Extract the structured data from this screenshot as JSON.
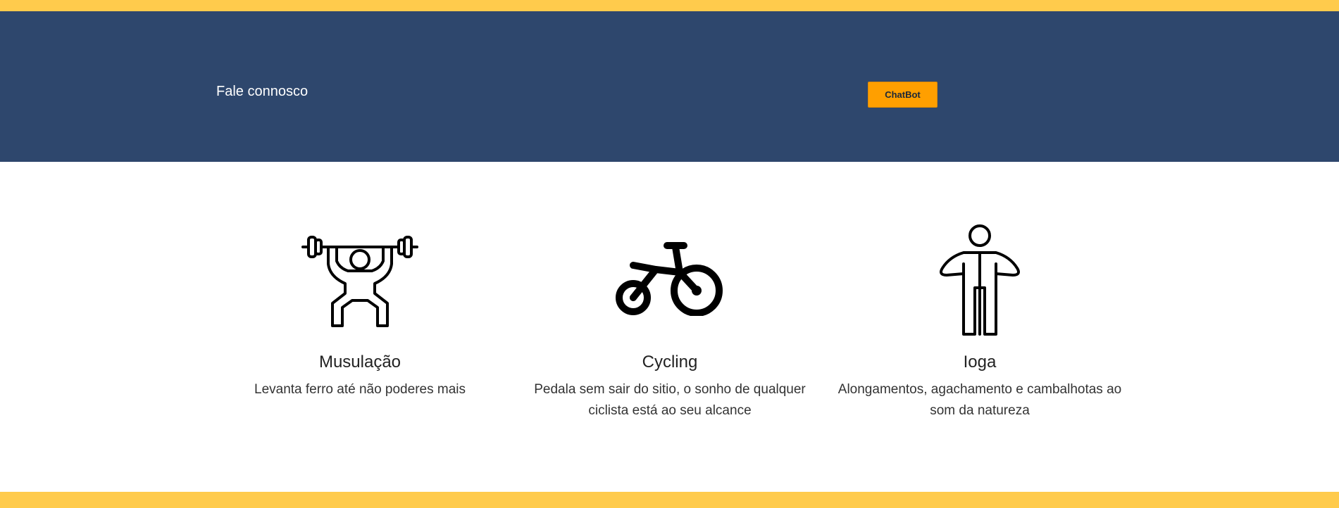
{
  "header": {
    "contact_title": "Fale connosco",
    "chatbot_label": "ChatBot"
  },
  "services": [
    {
      "icon": "weightlifting-icon",
      "title": "Musulação",
      "description": "Levanta ferro até não poderes mais"
    },
    {
      "icon": "bicycle-icon",
      "title": "Cycling",
      "description": "Pedala sem sair do sitio, o sonho de qualquer ciclista está ao seu alcance"
    },
    {
      "icon": "person-stretching-icon",
      "title": "Ioga",
      "description": "Alongamentos, agachamento e cambalhotas ao som da natureza"
    }
  ],
  "colors": {
    "accent_bar": "#ffcb4c",
    "hero_background": "#2e476d",
    "chatbot_button": "#ff9f00"
  }
}
